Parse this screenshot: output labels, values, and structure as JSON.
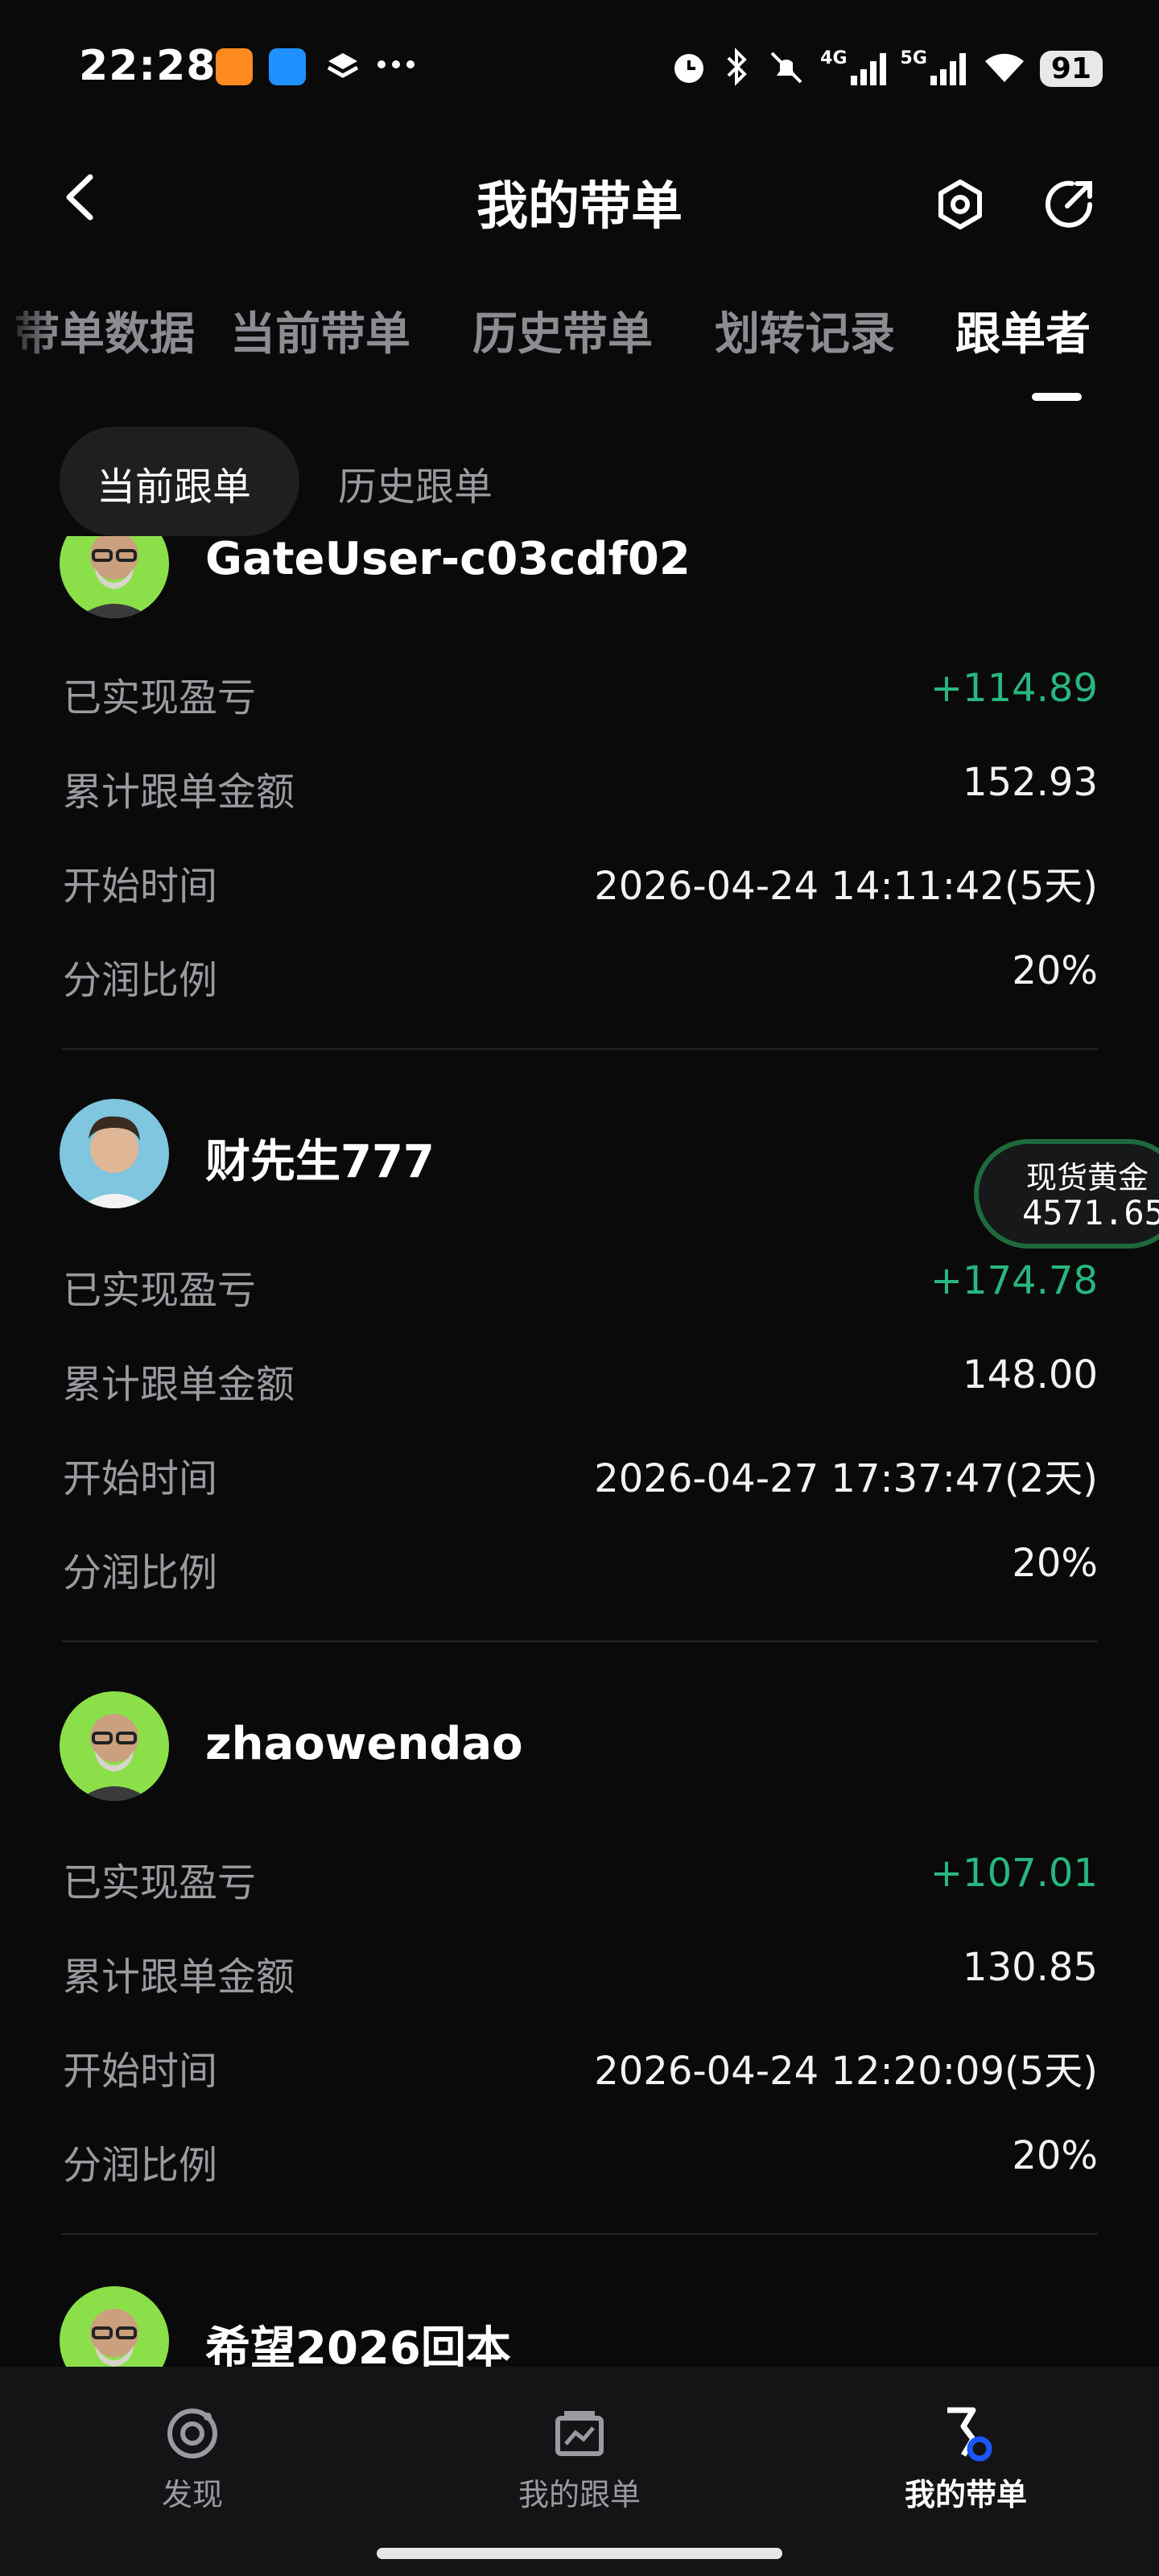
{
  "status_bar": {
    "time": "22:28",
    "network_1": "4G",
    "network_2": "5G",
    "battery": "91"
  },
  "header": {
    "title": "我的带单"
  },
  "tabs": [
    {
      "label": "带单数据"
    },
    {
      "label": "当前带单"
    },
    {
      "label": "历史带单"
    },
    {
      "label": "划转记录"
    },
    {
      "label": "跟单者"
    }
  ],
  "subtabs": [
    {
      "label": "当前跟单"
    },
    {
      "label": "历史跟单"
    }
  ],
  "labels": {
    "realized_pnl": "已实现盈亏",
    "total_amount": "累计跟单金额",
    "start_time": "开始时间",
    "profit_share": "分润比例"
  },
  "followers": [
    {
      "name": "GateUser-c03cdf02",
      "pnl": "+114.89",
      "amount": "152.93",
      "start": "2026-04-24 14:11:42(5天)",
      "share": "20%"
    },
    {
      "name": "财先生777",
      "pnl": "+174.78",
      "amount": "148.00",
      "start": "2026-04-27 17:37:47(2天)",
      "share": "20%"
    },
    {
      "name": "zhaowendao",
      "pnl": "+107.01",
      "amount": "130.85",
      "start": "2026-04-24 12:20:09(5天)",
      "share": "20%"
    },
    {
      "name": "希望2026回本"
    }
  ],
  "float_widget": {
    "label": "现货黄金",
    "value": "4571.65"
  },
  "bottom_nav": [
    {
      "label": "发现",
      "icon": "discover-icon"
    },
    {
      "label": "我的跟单",
      "icon": "chart-card-icon"
    },
    {
      "label": "我的带单",
      "icon": "lead-trade-icon"
    }
  ],
  "colors": {
    "profit": "#28b77e",
    "avatar_green": "#8be04a",
    "background": "#0a0a0b"
  }
}
